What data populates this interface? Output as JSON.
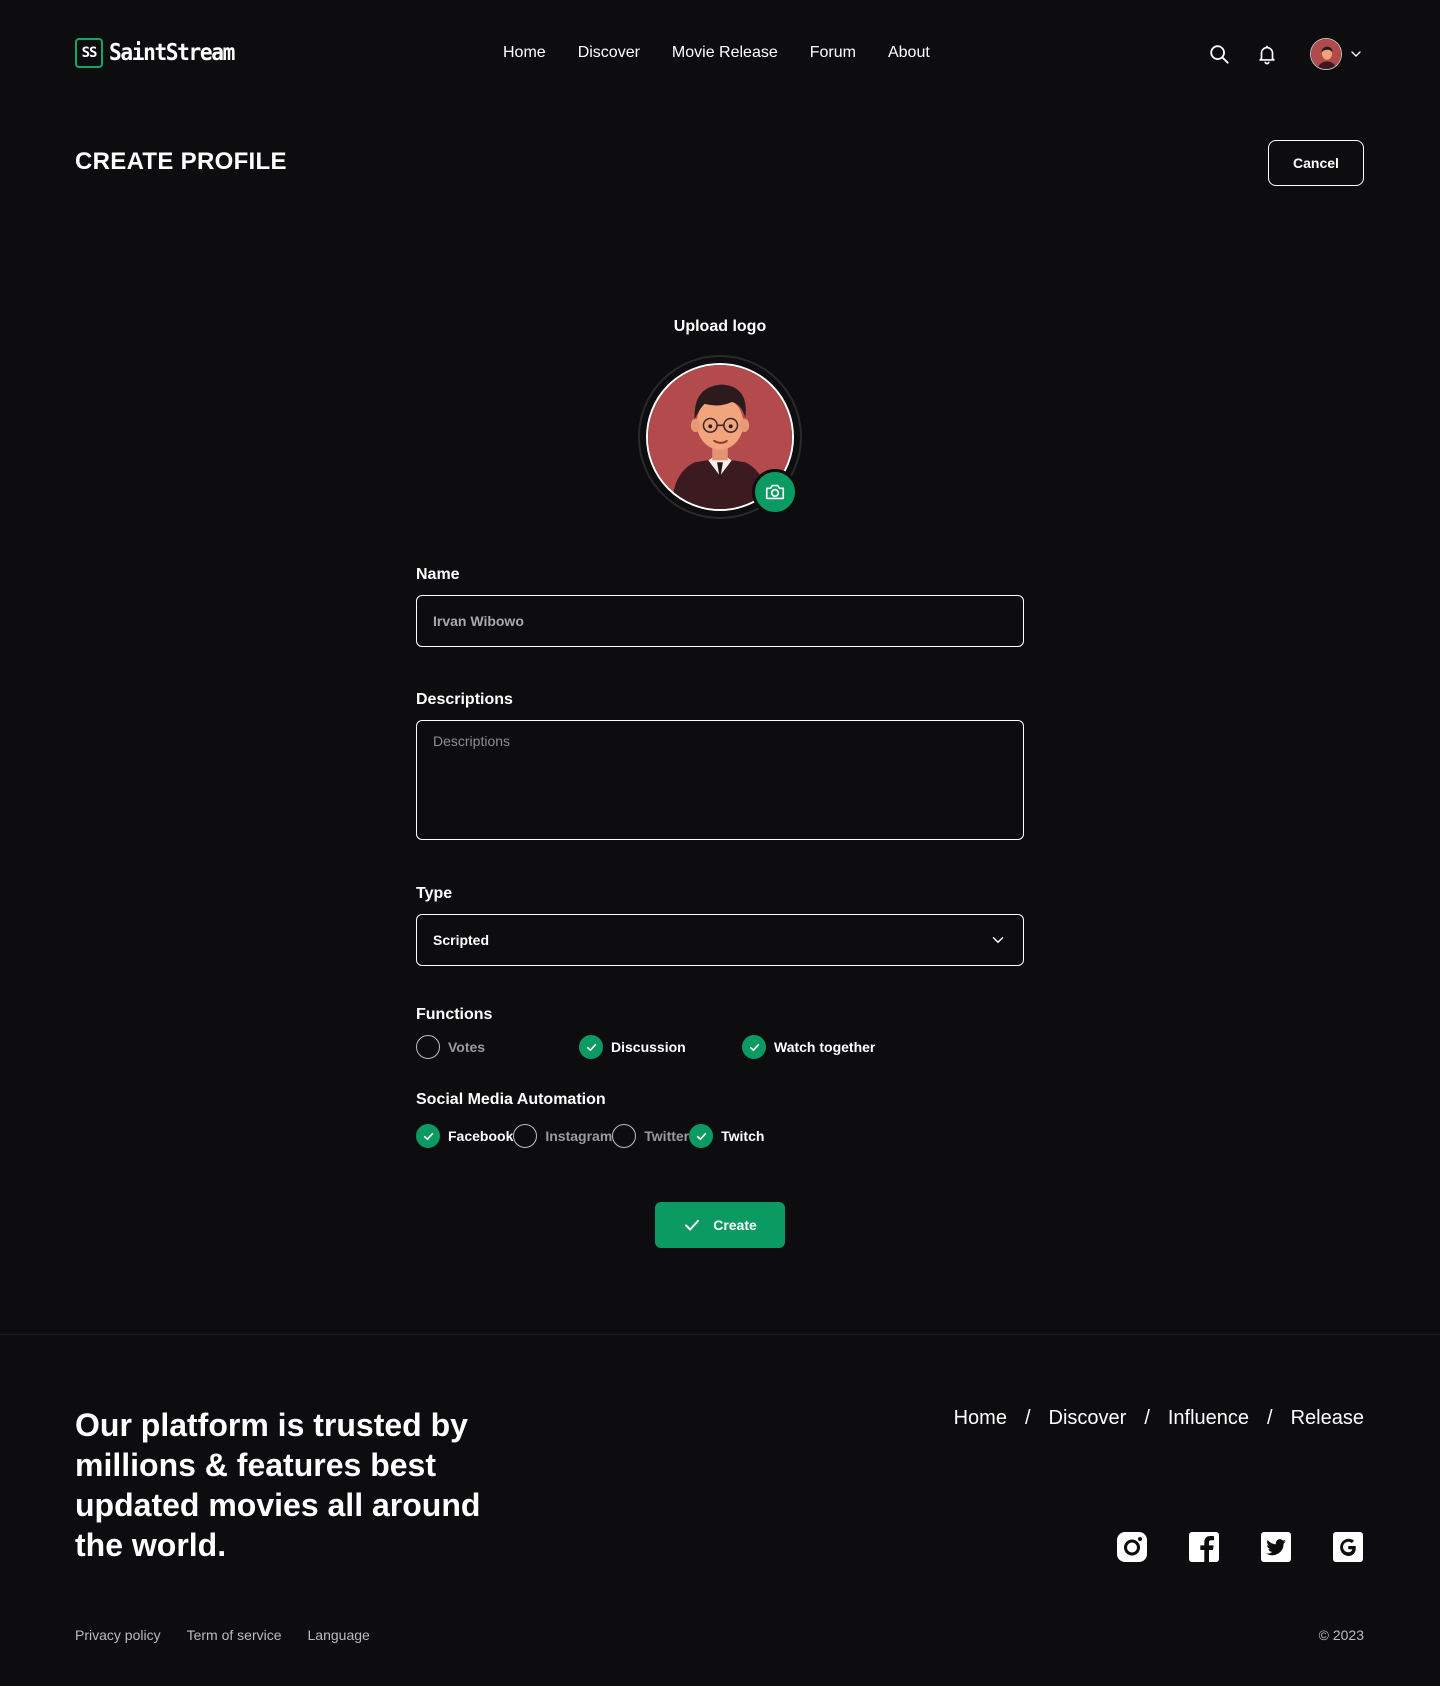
{
  "brand": {
    "mark": "SS",
    "name": "SaintStream"
  },
  "nav": {
    "links": [
      "Home",
      "Discover",
      "Movie Release",
      "Forum",
      "About"
    ],
    "icons": {
      "search": "search-icon",
      "notifications": "bell-icon",
      "menu": "chevron-down-icon"
    }
  },
  "header": {
    "title": "CREATE PROFILE",
    "cancel_label": "Cancel"
  },
  "upload": {
    "label": "Upload logo",
    "button_icon": "camera-icon"
  },
  "form": {
    "name": {
      "label": "Name",
      "value": "Irvan Wibowo"
    },
    "descriptions": {
      "label": "Descriptions",
      "placeholder": "Descriptions"
    },
    "type": {
      "label": "Type",
      "selected": "Scripted"
    },
    "functions": {
      "label": "Functions",
      "options": [
        {
          "label": "Votes",
          "checked": false
        },
        {
          "label": "Discussion",
          "checked": true
        },
        {
          "label": "Watch together",
          "checked": true
        }
      ]
    },
    "social": {
      "label": "Social Media Automation",
      "options": [
        {
          "label": "Facebook",
          "checked": true
        },
        {
          "label": "Instagram",
          "checked": false
        },
        {
          "label": "Twitter",
          "checked": false
        },
        {
          "label": "Twitch",
          "checked": true
        }
      ]
    },
    "create_label": "Create"
  },
  "footer": {
    "tagline": "Our platform is trusted by millions & features best updated movies all around the world.",
    "links": [
      "Home",
      "Discover",
      "Influence",
      "Release"
    ],
    "separator": "/",
    "socials": [
      "instagram-icon",
      "facebook-icon",
      "twitter-icon",
      "google-icon"
    ],
    "legal": [
      "Privacy policy",
      "Term of service",
      "Language"
    ],
    "copyright": "© 2023"
  },
  "colors": {
    "accent": "#0b9a62",
    "background": "#0d0d0f",
    "text": "#ffffff"
  }
}
